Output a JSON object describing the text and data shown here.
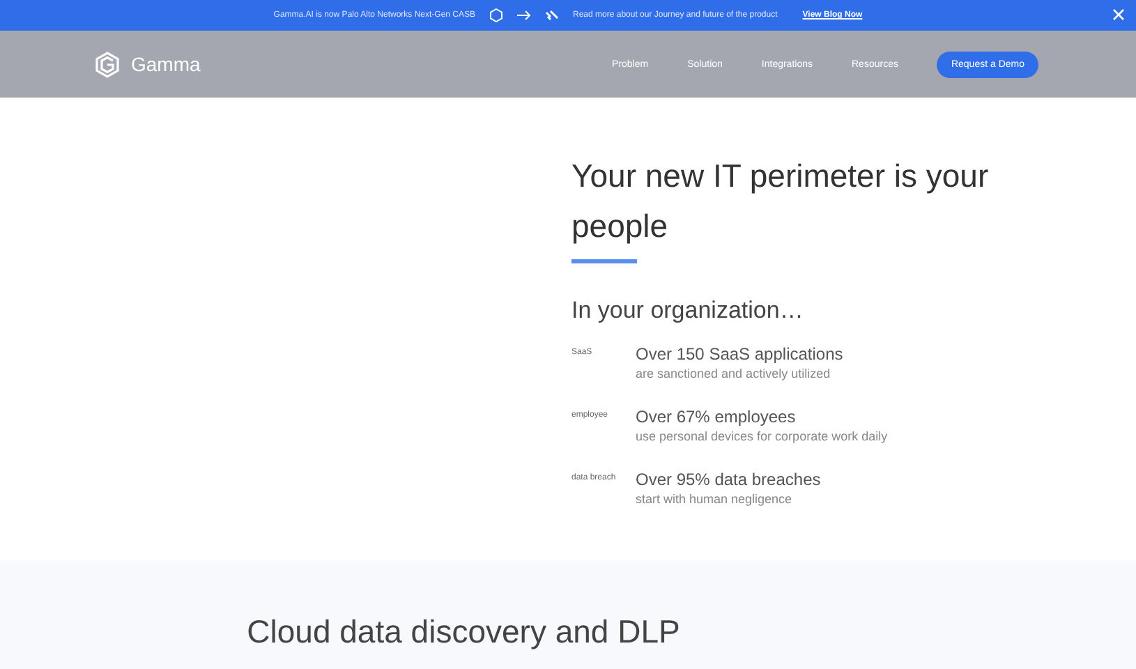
{
  "banner": {
    "text": "Gamma.AI is now Palo Alto Networks Next-Gen CASB",
    "link_text": "Read more about our Journey and future of the product",
    "link": "View Blog Now"
  },
  "nav": {
    "brand": "Gamma",
    "items": [
      "Problem",
      "Solution",
      "Integrations",
      "Resources"
    ],
    "cta": "Request a Demo"
  },
  "hero": {
    "title": "Your new IT perimeter is your people",
    "subtitle": "In your organization…",
    "stats": [
      {
        "alt": "SaaS",
        "headline": "Over 150 SaaS applications",
        "detail": "are sanctioned and actively utilized"
      },
      {
        "alt": "employee",
        "headline": "Over 67% employees",
        "detail": "use personal devices for corporate work daily"
      },
      {
        "alt": "data breach",
        "headline": "Over 95% data breaches",
        "detail": "start with human negligence"
      }
    ]
  },
  "section": {
    "title": "Cloud data discovery and DLP"
  }
}
